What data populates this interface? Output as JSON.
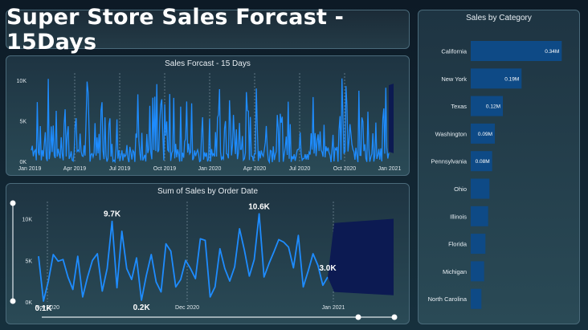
{
  "header": {
    "title": "Super Store Sales Forcast - 15Days"
  },
  "colors": {
    "accent": "#1e8cff",
    "forecast": "#0c1a52",
    "bar": "#0e4a86",
    "border": "#4a6a7a"
  },
  "chart_data": [
    {
      "id": "forecast",
      "type": "line",
      "title": "Sales Forcast - 15 Days",
      "ylabel": "",
      "xlabel": "",
      "y_ticks": [
        "0K",
        "5K",
        "10K"
      ],
      "x_ticks": [
        "Jan 2019",
        "Apr 2019",
        "Jul 2019",
        "Oct 2019",
        "Jan 2020",
        "Apr 2020",
        "Jul 2020",
        "Oct 2020",
        "Jan 2021"
      ],
      "ylim": [
        0,
        11000
      ],
      "x_range": [
        "2019-01-01",
        "2021-01-15"
      ],
      "forecast_days": 15
    },
    {
      "id": "by_date",
      "type": "line",
      "title": "Sum of Sales by Order Date",
      "ylabel": "",
      "xlabel": "",
      "y_ticks": [
        "0K",
        "5K",
        "10K"
      ],
      "x_ticks": [
        "Nov 2020",
        "Dec 2020",
        "Jan 2021"
      ],
      "ylim": [
        0,
        11500
      ],
      "x_range": [
        "2020-11-01",
        "2021-01-15"
      ],
      "values": [
        5500,
        100,
        2500,
        5700,
        4900,
        5100,
        3000,
        1500,
        5500,
        600,
        3000,
        5000,
        5800,
        1300,
        4000,
        9700,
        1700,
        8500,
        4000,
        2700,
        5300,
        200,
        3200,
        5700,
        2400,
        1200,
        7000,
        6100,
        1800,
        2700,
        5000,
        4000,
        2800,
        7600,
        7400,
        600,
        1800,
        6400,
        4000,
        2500,
        4200,
        8800,
        6200,
        3100,
        5100,
        10600,
        3000,
        4600,
        6000,
        7500,
        7200,
        6600,
        4100,
        8000,
        1800,
        3700,
        5800,
        4400,
        2000,
        3000
      ],
      "data_labels": [
        {
          "index": 1,
          "text": "0.1K"
        },
        {
          "index": 15,
          "text": "9.7K"
        },
        {
          "index": 21,
          "text": "0.2K"
        },
        {
          "index": 45,
          "text": "10.6K"
        },
        {
          "index": 59,
          "text": "3.0K"
        }
      ]
    },
    {
      "id": "by_category",
      "type": "bar",
      "title": "Sales by Category",
      "categories": [
        "California",
        "New York",
        "Texas",
        "Washington",
        "Pennsylvania",
        "Ohio",
        "Illinois",
        "Florida",
        "Michigan",
        "North Carolina"
      ],
      "values": [
        0.34,
        0.19,
        0.12,
        0.09,
        0.08,
        0.07,
        0.065,
        0.055,
        0.05,
        0.04
      ],
      "value_labels": [
        "0.34M",
        "0.19M",
        "0.12M",
        "0.09M",
        "0.08M",
        "",
        "",
        "",
        "",
        ""
      ],
      "xlim": [
        0,
        0.36
      ]
    }
  ]
}
